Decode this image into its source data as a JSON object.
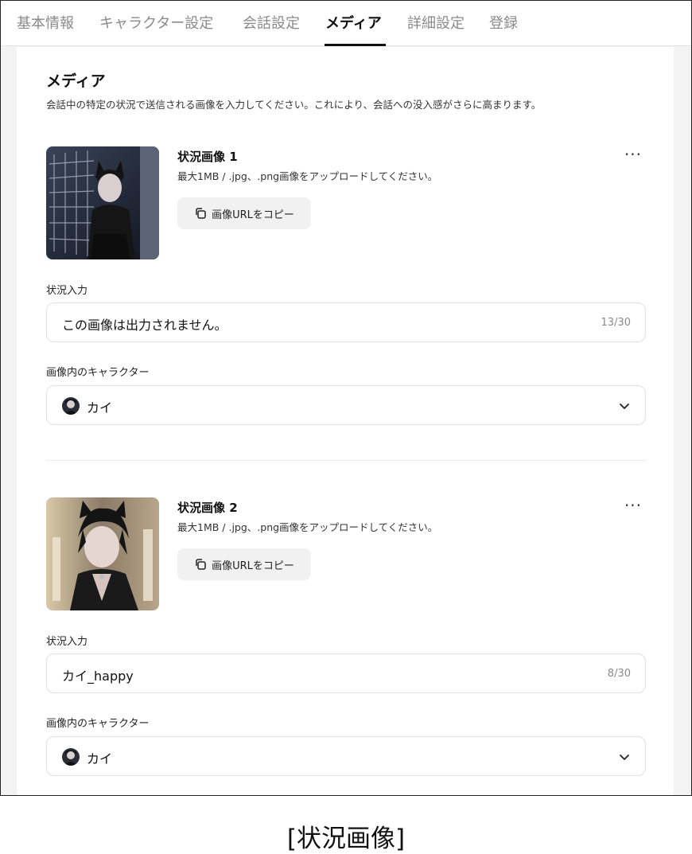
{
  "tabs": [
    {
      "label": "基本情報"
    },
    {
      "label": "キャラクター設定"
    },
    {
      "label": "会話設定"
    },
    {
      "label": "メディア",
      "active": true
    },
    {
      "label": "詳細設定"
    },
    {
      "label": "登録"
    }
  ],
  "section": {
    "title": "メディア",
    "description": "会話中の特定の状況で送信される画像を入力してください。これにより、会話への没入感がさらに高まります。"
  },
  "images": [
    {
      "title": "状況画像 1",
      "hint": "最大1MB / .jpg、.png画像をアップロードしてください。",
      "copy_label": "画像URLをコピー",
      "situation_label": "状況入力",
      "situation_value": "この画像は出力されません。",
      "counter": "13/30",
      "character_label": "画像内のキャラクター",
      "character_value": "カイ"
    },
    {
      "title": "状況画像 2",
      "hint": "最大1MB / .jpg、.png画像をアップロードしてください。",
      "copy_label": "画像URLをコピー",
      "situation_label": "状況入力",
      "situation_value": "カイ_happy",
      "counter": "8/30",
      "character_label": "画像内のキャラクター",
      "character_value": "カイ"
    }
  ],
  "caption": "[状況画像]",
  "colors": {
    "active_tab": "#111111",
    "inactive_tab": "#8a8a8a",
    "page_bg": "#f3f3f3",
    "button_bg": "#f1f1f1",
    "border": "#e1e1e1"
  },
  "icons": {
    "copy": "copy-icon",
    "more": "more-dots-icon",
    "chevron": "chevron-down-icon"
  }
}
